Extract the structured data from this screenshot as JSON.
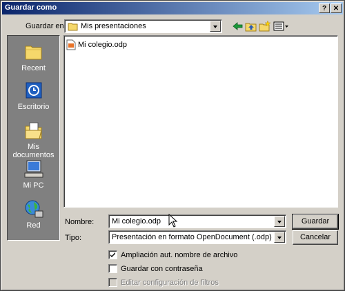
{
  "window": {
    "title": "Guardar como",
    "help_label": "?",
    "close_label": "✕"
  },
  "save_in": {
    "label": "Guardar en:",
    "value": "Mis presentaciones"
  },
  "sidebar": {
    "items": [
      {
        "label": "Recent",
        "icon": "folder-icon"
      },
      {
        "label": "Escritorio",
        "icon": "desktop-icon"
      },
      {
        "label": "Mis documentos",
        "icon": "my-documents-icon"
      },
      {
        "label": "Mi PC",
        "icon": "my-computer-icon"
      },
      {
        "label": "Red",
        "icon": "network-icon"
      }
    ]
  },
  "files": [
    {
      "name": "Mi colegio.odp",
      "icon": "presentation-file-icon"
    }
  ],
  "filename": {
    "label": "Nombre:",
    "value": "Mi colegio.odp"
  },
  "filetype": {
    "label": "Tipo:",
    "value": "Presentación en formato OpenDocument (.odp)"
  },
  "buttons": {
    "save": "Guardar",
    "cancel": "Cancelar"
  },
  "options": {
    "auto_extension": {
      "label": "Ampliación aut. nombre de archivo",
      "checked": true
    },
    "password": {
      "label": "Guardar con contraseña",
      "checked": false
    },
    "filter": {
      "label": "Editar configuración de filtros",
      "checked": false,
      "disabled": true
    }
  },
  "colors": {
    "title_start": "#0a246a",
    "title_end": "#a6caf0",
    "dialog_bg": "#d4d0c8",
    "sidebar_bg": "#808080"
  }
}
